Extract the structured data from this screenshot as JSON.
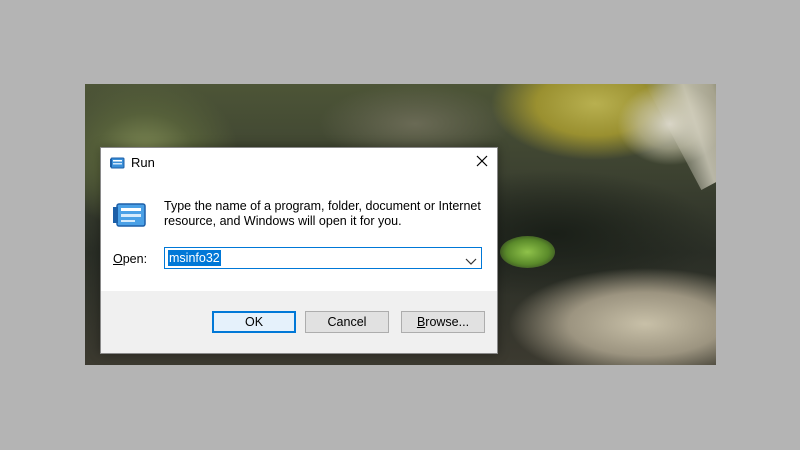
{
  "dialog": {
    "title": "Run",
    "description": "Type the name of a program, folder, document or Internet resource, and Windows will open it for you.",
    "open_label_prefix": "",
    "open_label_underlined": "O",
    "open_label_rest": "pen:",
    "input_value": "msinfo32"
  },
  "buttons": {
    "ok_label": "OK",
    "cancel_label": "Cancel",
    "browse_underlined": "B",
    "browse_rest": "rowse..."
  },
  "icons": {
    "title": "run-icon",
    "body": "run-icon",
    "close": "close-icon",
    "dropdown": "chevron-down-icon"
  },
  "colors": {
    "accent": "#0078d7",
    "background": "#b4b4b4",
    "footer": "#f0f0f0"
  }
}
